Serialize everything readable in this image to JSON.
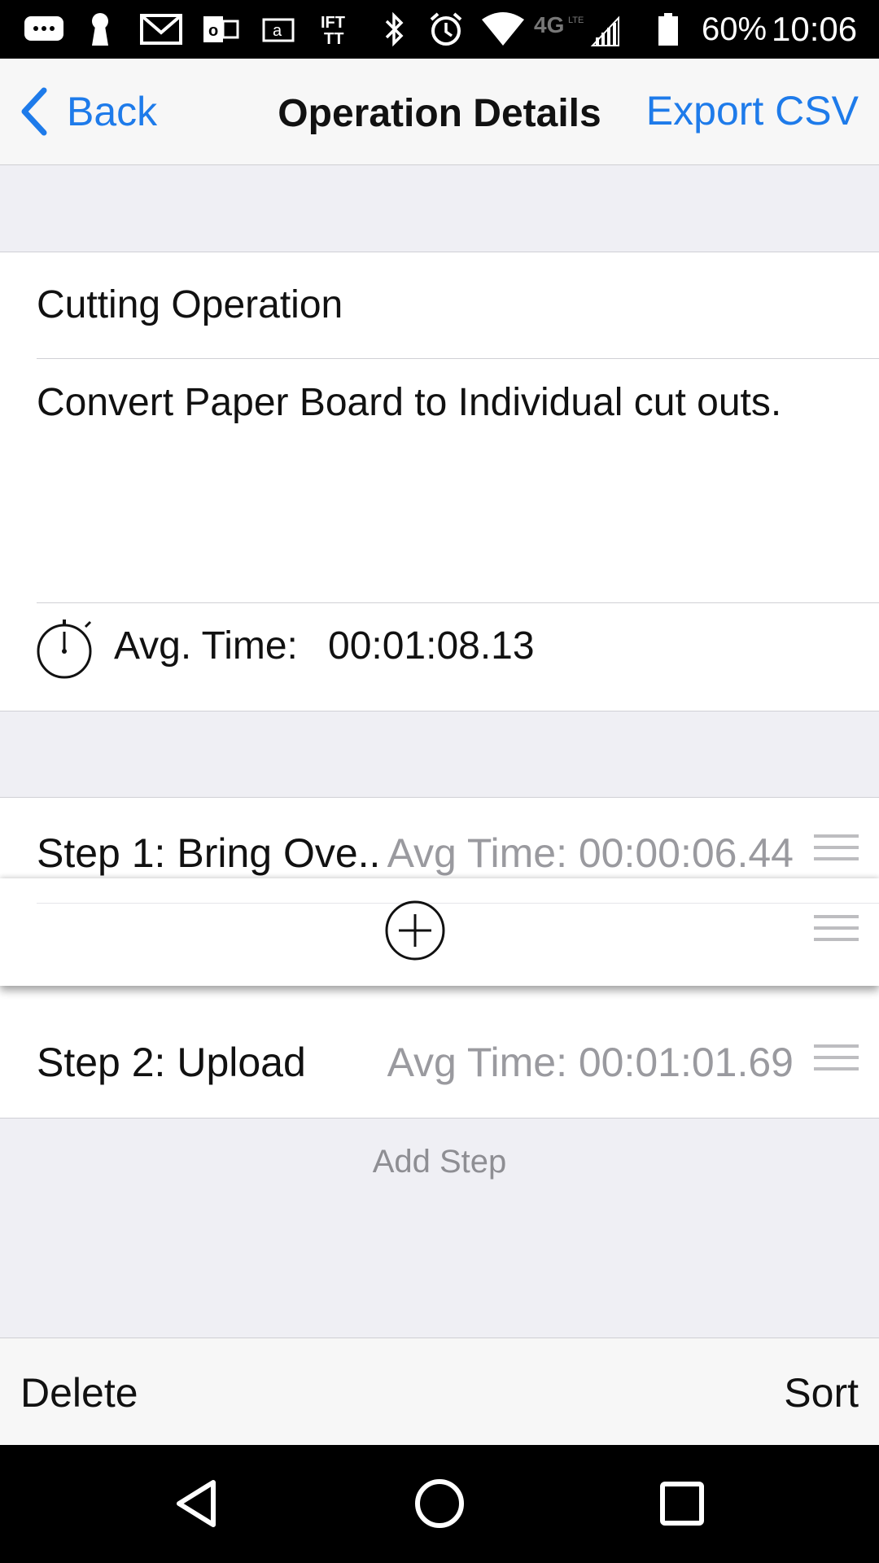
{
  "status_bar": {
    "battery": "60%",
    "time": "10:06",
    "network": "4G LTE",
    "icons": [
      "chat-icon",
      "keyhole-icon",
      "gmail-icon",
      "outlook-icon",
      "amazon-icon",
      "ifttt-icon",
      "bluetooth-icon",
      "alarm-icon",
      "wifi-icon",
      "network-4g-icon",
      "signal-icon",
      "battery-icon"
    ]
  },
  "nav": {
    "back_label": "Back",
    "title": "Operation Details",
    "export_label": "Export CSV"
  },
  "operation": {
    "name": "Cutting Operation",
    "description": "Convert Paper Board to Individual cut outs.",
    "avg_time_label": "Avg. Time:",
    "avg_time_value": "00:01:08.13"
  },
  "steps": [
    {
      "title": "Step 1: Bring Ove..",
      "avg_time": "Avg Time: 00:00:06.44"
    },
    {
      "title": "Step 2: Upload",
      "avg_time": "Avg Time: 00:01:01.69"
    }
  ],
  "add_step_label": "Add Step",
  "toolbar": {
    "delete_label": "Delete",
    "sort_label": "Sort"
  },
  "colors": {
    "accent": "#1e7bea",
    "background": "#efeff4",
    "secondary_text": "#9a9a9f"
  }
}
